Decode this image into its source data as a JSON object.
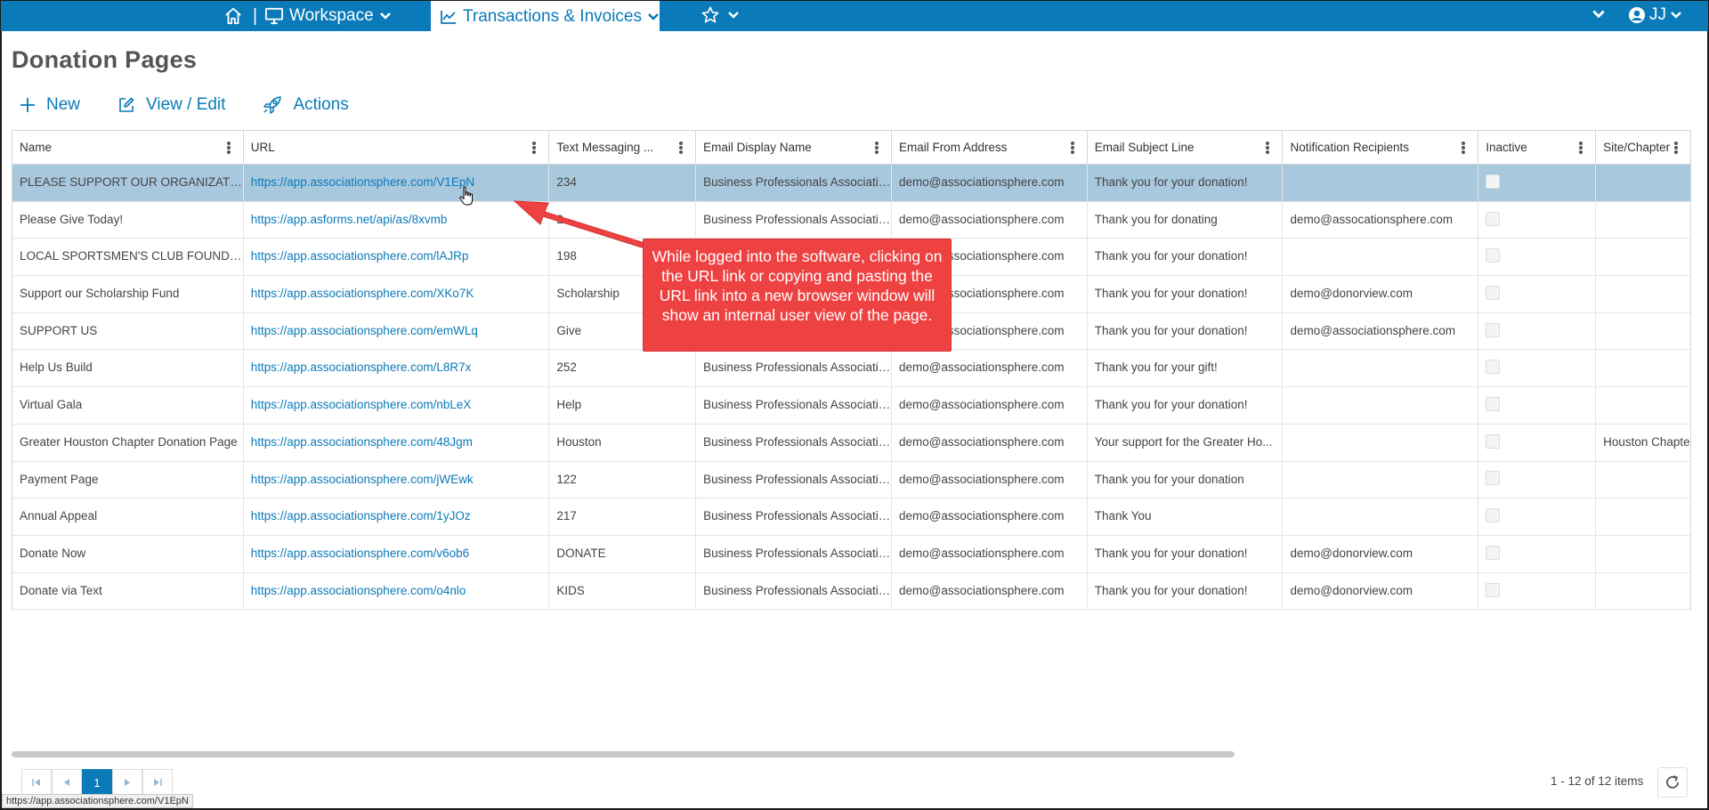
{
  "topbar": {
    "home_icon": "home-icon",
    "separator": "|",
    "workspace_label": "Workspace",
    "active_tab_label": "Transactions & Invoices",
    "favorites_icon": "star-icon",
    "user_initials": "JJ"
  },
  "page": {
    "title": "Donation Pages"
  },
  "toolbar": {
    "new_label": "New",
    "view_edit_label": "View / Edit",
    "actions_label": "Actions"
  },
  "grid": {
    "columns": [
      "Name",
      "URL",
      "Text Messaging ...",
      "Email Display Name",
      "Email From Address",
      "Email Subject Line",
      "Notification Recipients",
      "Inactive",
      "Site/Chapter"
    ],
    "rows": [
      {
        "name": "PLEASE SUPPORT OUR ORGANIZATION",
        "url": "https://app.associationsphere.com/V1EpN",
        "text": "234",
        "display": "Business Professionals Association",
        "from": "demo@associationsphere.com",
        "subject": "Thank you for your donation!",
        "recipients": "",
        "site": "",
        "selected": true
      },
      {
        "name": "Please Give Today!",
        "url": "https://app.asforms.net/api/as/8xvmb",
        "text": "2",
        "display": "Business Professionals Association",
        "from": "demo@associationsphere.com",
        "subject": "Thank you for donating",
        "recipients": "demo@assocationsphere.com",
        "site": ""
      },
      {
        "name": "LOCAL SPORTSMEN'S CLUB FOUNDATI...",
        "url": "https://app.associationsphere.com/lAJRp",
        "text": "198",
        "display": "Business Professionals Association",
        "from": "demo@associationsphere.com",
        "subject": "Thank you for your donation!",
        "recipients": "",
        "site": ""
      },
      {
        "name": "Support our Scholarship Fund",
        "url": "https://app.associationsphere.com/XKo7K",
        "text": "Scholarship",
        "display": "Business Professionals Association",
        "from": "demo@associationsphere.com",
        "subject": "Thank you for your donation!",
        "recipients": "demo@donorview.com",
        "site": ""
      },
      {
        "name": "SUPPORT US",
        "url": "https://app.associationsphere.com/emWLq",
        "text": "Give",
        "display": "Business Professionals Association",
        "from": "demo@associationsphere.com",
        "subject": "Thank you for your donation!",
        "recipients": "demo@associationsphere.com",
        "site": ""
      },
      {
        "name": "Help Us Build",
        "url": "https://app.associationsphere.com/L8R7x",
        "text": "252",
        "display": "Business Professionals Association",
        "from": "demo@associationsphere.com",
        "subject": "Thank you for your gift!",
        "recipients": "",
        "site": ""
      },
      {
        "name": "Virtual Gala",
        "url": "https://app.associationsphere.com/nbLeX",
        "text": "Help",
        "display": "Business Professionals Association",
        "from": "demo@associationsphere.com",
        "subject": "Thank you for your donation!",
        "recipients": "",
        "site": ""
      },
      {
        "name": "Greater Houston Chapter Donation Page",
        "url": "https://app.associationsphere.com/48Jgm",
        "text": "Houston",
        "display": "Business Professionals Association",
        "from": "demo@associationsphere.com",
        "subject": "Your support for the Greater Ho...",
        "recipients": "",
        "site": "Houston Chapte"
      },
      {
        "name": "Payment Page",
        "url": "https://app.associationsphere.com/jWEwk",
        "text": "122",
        "display": "Business Professionals Association",
        "from": "demo@associationsphere.com",
        "subject": "Thank you for your donation",
        "recipients": "",
        "site": ""
      },
      {
        "name": "Annual Appeal",
        "url": "https://app.associationsphere.com/1yJOz",
        "text": "217",
        "display": "Business Professionals Association",
        "from": "demo@associationsphere.com",
        "subject": "Thank You",
        "recipients": "",
        "site": ""
      },
      {
        "name": "Donate Now",
        "url": "https://app.associationsphere.com/v6ob6",
        "text": "DONATE",
        "display": "Business Professionals Association",
        "from": "demo@associationsphere.com",
        "subject": "Thank you for your donation!",
        "recipients": "demo@donorview.com",
        "site": ""
      },
      {
        "name": "Donate via Text",
        "url": "https://app.associationsphere.com/o4nlo",
        "text": "KIDS",
        "display": "Business Professionals Association",
        "from": "demo@associationsphere.com",
        "subject": "Thank you for your donation!",
        "recipients": "demo@donorview.com",
        "site": ""
      }
    ]
  },
  "pager": {
    "current_page": "1",
    "info": "1 - 12 of 12 items"
  },
  "status_bar_url": "https://app.associationsphere.com/V1EpN",
  "callout": {
    "text": "While logged into the software, clicking on the URL link or copying and pasting the URL link into a new browser window will show an internal user view of the page."
  },
  "colors": {
    "brand": "#0a7ab8",
    "selected_row": "#a8c8de",
    "callout": "#ee4242"
  }
}
